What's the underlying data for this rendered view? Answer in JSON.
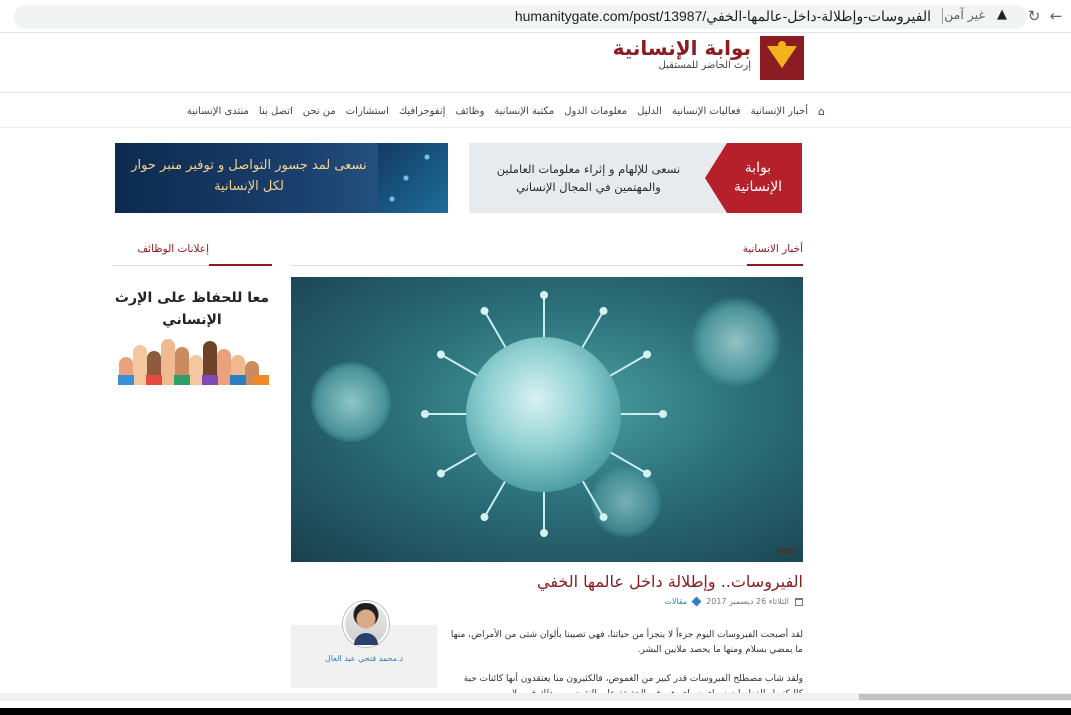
{
  "browser": {
    "url": "humanitygate.com/post/13987/الفيروسات-وإطلالة-داخل-عالمها-الخفي",
    "security_label": "غير آمن",
    "reload_icon": "reload-icon",
    "back_icon": "back-arrow-icon",
    "warning_icon": "warning-icon"
  },
  "site": {
    "logo": {
      "title": "بوابة الإنسانية",
      "tagline": "إرث الحاضر للمستقبل"
    },
    "nav": [
      "أخبار الإنسانية",
      "فعاليات الإنسانية",
      "الدليل",
      "معلومات الدول",
      "مكتبة الإنسانية",
      "وظائف",
      "إنفوجرافيك",
      "استشارات",
      "من نحن",
      "اتصل بنا",
      "منتدى الإنسانية"
    ],
    "banners": {
      "right_title": "بوابة الإنسانية",
      "right_text": "نسعى للإلهام و إثراء معلومات العاملين والمهتمين في المجال الإنساني",
      "left_text": "نسعى لمد جسور التواصل و توفير منبر حوار لكل الإنسانية"
    },
    "section_main": "أخبار الانسانية",
    "section_side": "إعلانات الوظائف",
    "side_ad_text": "معا للحفاظ على الإرث الإنساني",
    "post": {
      "title": "الفيروسات.. وإطلالة داخل عالمها الخفي",
      "date": "الثلاثاء 26 ديسمبر 2017",
      "category": "مقالات",
      "author": "د.محمد فتحي عبد العال",
      "p1": "لقد أصبحت الفيروسات اليوم جزءاً لا يتجزأ من حياتنا، فهي تصيبنا بألوان شتى من الأمراض، منها ما يمضي بسلام ومنها ما يحصد ملايين البشر.",
      "p2": "ولقد شاب مصطلح الفيروسات قدر كبير من الغموض، فالكثيرون منا يعتقدون أنها كائنات حية كالبكتريا والفطريات سواء بسواء وهي في الحقيقة على النقيض من ذلك فهي لا"
    }
  },
  "colors": {
    "brand": "#8a1c22",
    "link": "#2f7fc1",
    "logo_gold": "#f4b31c"
  }
}
